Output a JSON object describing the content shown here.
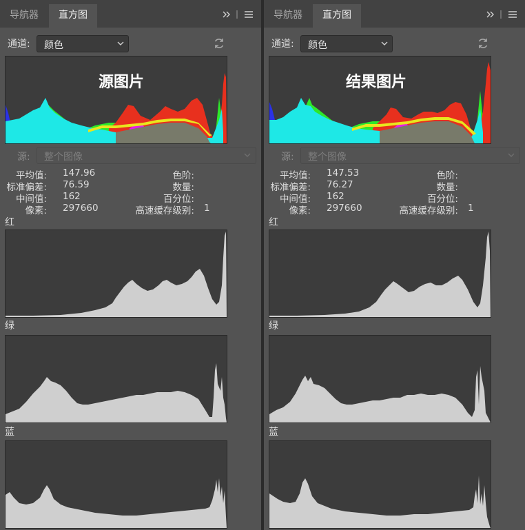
{
  "panels": [
    {
      "tabs": [
        "导航器",
        "直方图"
      ],
      "channel_label": "通道:",
      "channel_value": "颜色",
      "overlay_text": "源图片",
      "source_label": "源:",
      "source_value": "整个图像",
      "stats": {
        "mean_label": "平均值:",
        "mean": "147.96",
        "std_label": "标准偏差:",
        "std": "76.59",
        "median_label": "中间值:",
        "median": "162",
        "pixels_label": "像素:",
        "pixels": "297660",
        "level_label": "色阶:",
        "count_label": "数量:",
        "percentile_label": "百分位:",
        "cache_label": "高速缓存级别:",
        "cache": "1"
      },
      "channels": [
        "红",
        "绿",
        "蓝"
      ]
    },
    {
      "tabs": [
        "导航器",
        "直方图"
      ],
      "channel_label": "通道:",
      "channel_value": "颜色",
      "overlay_text": "结果图片",
      "source_label": "源:",
      "source_value": "整个图像",
      "stats": {
        "mean_label": "平均值:",
        "mean": "147.53",
        "std_label": "标准偏差:",
        "std": "76.27",
        "median_label": "中间值:",
        "median": "162",
        "pixels_label": "像素:",
        "pixels": "297660",
        "level_label": "色阶:",
        "count_label": "数量:",
        "percentile_label": "百分位:",
        "cache_label": "高速缓存级别:",
        "cache": "1"
      },
      "channels": [
        "红",
        "绿",
        "蓝"
      ]
    }
  ],
  "colors": {
    "panel_bg": "#535353",
    "histogram_bg": "#3c3c3c",
    "histogram_fill": "#cfcfcf",
    "red": "#e8301e",
    "green": "#2ee82a",
    "blue": "#2a32e6",
    "cyan": "#1ee8e6",
    "yellow": "#e8e61e",
    "magenta": "#e61ee6",
    "gray_overlap": "#787a6a"
  },
  "icons": [
    "expand-chevrons-icon",
    "panel-menu-icon",
    "refresh-icon",
    "chevron-down-icon"
  ]
}
